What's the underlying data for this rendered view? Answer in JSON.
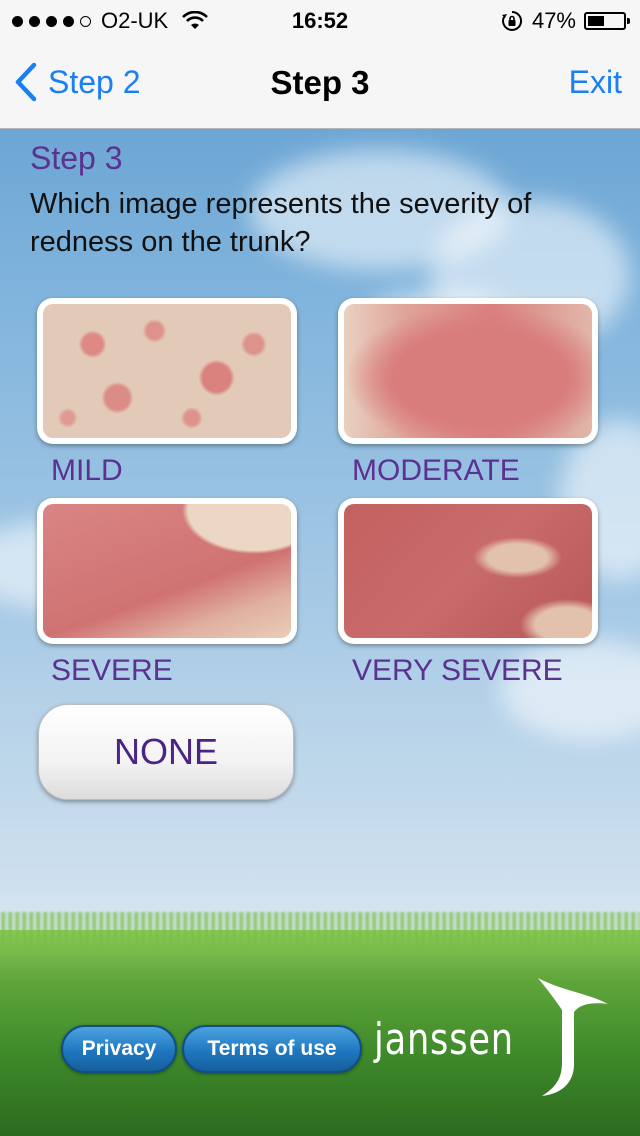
{
  "status_bar": {
    "carrier": "O2-UK",
    "time": "16:52",
    "battery_percent": "47%",
    "battery_level": 0.47,
    "signal_bars": 4,
    "signal_total": 5
  },
  "nav": {
    "back_label": "Step 2",
    "title": "Step 3",
    "exit_label": "Exit"
  },
  "content": {
    "step_heading": "Step 3",
    "question": "Which image represents the severity of redness on the trunk?"
  },
  "options": [
    {
      "label": "MILD",
      "image": "mild-redness-photo"
    },
    {
      "label": "MODERATE",
      "image": "moderate-redness-photo"
    },
    {
      "label": "SEVERE",
      "image": "severe-redness-photo"
    },
    {
      "label": "VERY SEVERE",
      "image": "very-severe-redness-photo"
    }
  ],
  "none_button": "NONE",
  "footer": {
    "privacy_label": "Privacy",
    "terms_label": "Terms of use",
    "brand": "janssen"
  },
  "colors": {
    "accent_blue": "#1a7ff3",
    "purple": "#5b3290",
    "pill_blue": "#1f77bf"
  },
  "icons": {
    "back": "chevron-left-icon",
    "wifi": "wifi-icon",
    "rotation_lock": "rotation-lock-icon",
    "battery": "battery-icon"
  }
}
